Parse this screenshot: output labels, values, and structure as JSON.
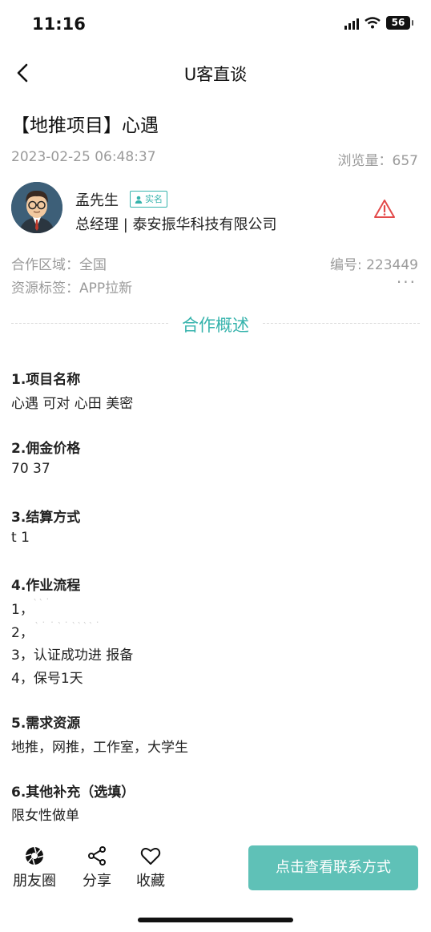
{
  "status_bar": {
    "time": "11:16",
    "battery": "56"
  },
  "nav": {
    "title": "U客直谈"
  },
  "project": {
    "title": "【地推项目】心遇",
    "date": "2023-02-25 06:48:37",
    "views": "浏览量：657"
  },
  "publisher": {
    "name": "孟先生",
    "badge": "实名",
    "role": "总经理 | 泰安振华科技有限公司"
  },
  "meta": {
    "region": "合作区域：全国",
    "serial": "编号: 223449",
    "tags": "资源标签：APP拉新",
    "more": "···"
  },
  "section_heading": "合作概述",
  "blocks": [
    {
      "title": "1.项目名称",
      "lines": [
        "心遇 可对 心田 美密"
      ]
    },
    {
      "title": "2.佣金价格",
      "lines": [
        "70 37"
      ]
    },
    {
      "title": "3.结算方式",
      "lines": [
        "t 1"
      ]
    },
    {
      "title": "4.作业流程",
      "lines": [
        "1，",
        "2，",
        "3，认证成功进  报备",
        "4，保号1天"
      ]
    },
    {
      "title": "5.需求资源",
      "lines": [
        "地推，网推，工作室，大学生"
      ]
    },
    {
      "title": "6.其他补充（选填）",
      "lines": [
        "限女性做单"
      ]
    }
  ],
  "bottom_bar": {
    "moments": "朋友圈",
    "share": "分享",
    "favorite": "收藏",
    "contact": "点击查看联系方式"
  },
  "colors": {
    "accent": "#36b3ac",
    "button": "#5fc1b7",
    "warning": "#e34a4a",
    "muted": "#9a9a9a"
  }
}
